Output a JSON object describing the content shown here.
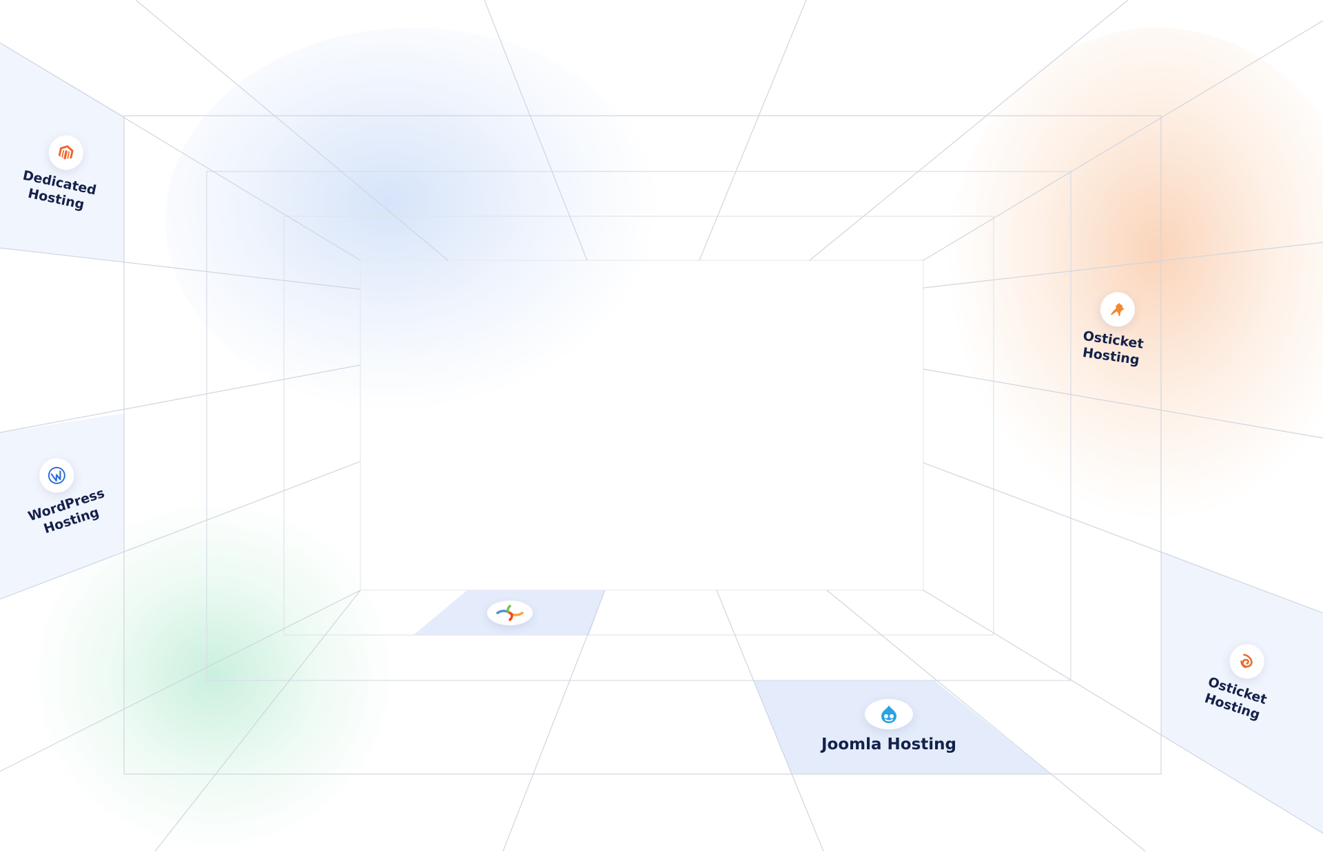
{
  "cards": {
    "dedicated": {
      "label": "Dedicated\nHosting",
      "icon": "magento-icon",
      "icon_color": "#ee672f"
    },
    "wordpress": {
      "label": "WordPress\nHosting",
      "icon": "wordpress-icon",
      "icon_color": "#2f6fd6"
    },
    "osticket_top": {
      "label": "Osticket\nHosting",
      "icon": "kangaroo-icon",
      "icon_color": "#f08a2c"
    },
    "osticket_bottom": {
      "label": "Osticket\nHosting",
      "icon": "swirl-icon",
      "icon_color": "#ea6c2e"
    },
    "joomla_floor": {
      "icon": "joomla-icon"
    },
    "joomla": {
      "label": "Joomla Hosting",
      "icon": "drupal-icon",
      "icon_color": "#2ba3e0"
    }
  },
  "colors": {
    "panel_fill": "#eef3fd",
    "floor_panel_fill": "#e4ecfb",
    "line": "#cfd5df",
    "text": "#14214a",
    "glow_blue": "#c8daf8",
    "glow_orange": "#f7b282",
    "glow_green": "#96e1be"
  }
}
